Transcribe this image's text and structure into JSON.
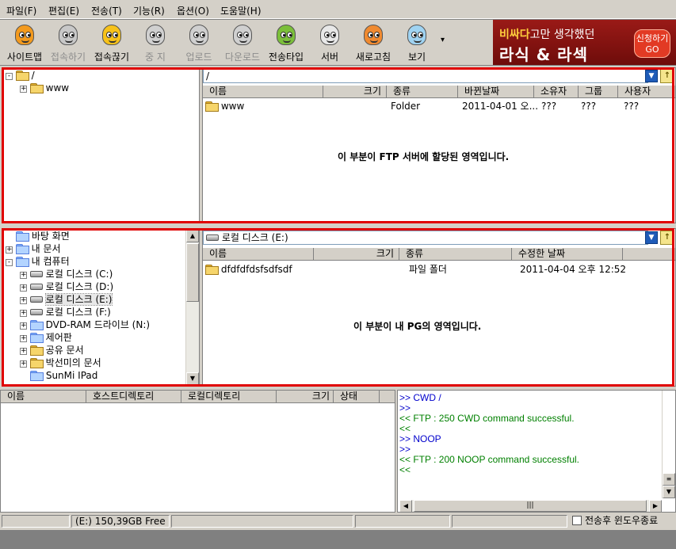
{
  "menu": [
    "파일(F)",
    "편집(E)",
    "전송(T)",
    "기능(R)",
    "옵션(O)",
    "도움말(H)"
  ],
  "toolbar": [
    {
      "label": "사이트맵",
      "icon": "sitemap-icon",
      "enabled": true,
      "color": "#f39a1e"
    },
    {
      "label": "접속하기",
      "icon": "connect-icon",
      "enabled": false,
      "color": "#c8c8c8"
    },
    {
      "label": "접속끊기",
      "icon": "disconnect-icon",
      "enabled": true,
      "color": "#f7c21a"
    },
    {
      "label": "중 지",
      "icon": "stop-icon",
      "enabled": false,
      "color": "#d0d0d0"
    },
    {
      "label": "업로드",
      "icon": "upload-icon",
      "enabled": false,
      "color": "#d0d0d0"
    },
    {
      "label": "다운로드",
      "icon": "download-icon",
      "enabled": false,
      "color": "#d0d0d0"
    },
    {
      "label": "전송타입",
      "icon": "transfer-type-icon",
      "enabled": true,
      "color": "#7bbf3a"
    },
    {
      "label": "서버",
      "icon": "server-icon",
      "enabled": true,
      "color": "#e8e8e8"
    },
    {
      "label": "새로고침",
      "icon": "refresh-icon",
      "enabled": true,
      "color": "#f08a30"
    },
    {
      "label": "보기",
      "icon": "view-icon",
      "enabled": true,
      "color": "#9fd3f2"
    }
  ],
  "ad": {
    "line1_hl": "비싸다",
    "line1_rest": "고만 생각했던",
    "line2": "라식 & 라섹",
    "button": "신청하기 GO"
  },
  "server": {
    "tree_root": "/",
    "tree_child": "www",
    "path": "/",
    "columns": [
      "이름",
      "크기",
      "종류",
      "바뀐날짜",
      "소유자",
      "그룹",
      "사용자"
    ],
    "rows": [
      {
        "name": "www",
        "size": "",
        "type": "Folder",
        "date": "2011-04-01 오...",
        "owner": "???",
        "group": "???",
        "user": "???"
      }
    ],
    "note": "이 부분이 FTP 서버에 할당된 영역입니다."
  },
  "local": {
    "tree": [
      {
        "label": "바탕 화면",
        "icon": "desktop-icon",
        "indent": 0,
        "expander": ""
      },
      {
        "label": "내 문서",
        "icon": "my-documents-icon",
        "indent": 0,
        "expander": "+"
      },
      {
        "label": "내 컴퓨터",
        "icon": "my-computer-icon",
        "indent": 0,
        "expander": "-"
      },
      {
        "label": "로컬 디스크 (C:)",
        "icon": "disk-icon",
        "indent": 1,
        "expander": "+"
      },
      {
        "label": "로컬 디스크 (D:)",
        "icon": "disk-icon",
        "indent": 1,
        "expander": "+"
      },
      {
        "label": "로컬 디스크 (E:)",
        "icon": "disk-icon",
        "indent": 1,
        "expander": "+",
        "selected": true
      },
      {
        "label": "로컬 디스크 (F:)",
        "icon": "disk-icon",
        "indent": 1,
        "expander": "+"
      },
      {
        "label": "DVD-RAM 드라이브 (N:)",
        "icon": "dvd-icon",
        "indent": 1,
        "expander": "+"
      },
      {
        "label": "제어판",
        "icon": "control-panel-icon",
        "indent": 1,
        "expander": "+"
      },
      {
        "label": "공유 문서",
        "icon": "folder-icon",
        "indent": 1,
        "expander": "+"
      },
      {
        "label": "박선미의 문서",
        "icon": "folder-icon",
        "indent": 1,
        "expander": "+"
      },
      {
        "label": "SunMi IPad",
        "icon": "camera-icon",
        "indent": 1,
        "expander": ""
      }
    ],
    "path": "로컬 디스크 (E:)",
    "columns": [
      "이름",
      "크기",
      "종류",
      "수정한 날짜"
    ],
    "rows": [
      {
        "name": "dfdfdfdsfsdfsdf",
        "size": "",
        "type": "파일 폴더",
        "date": "2011-04-04 오후 12:52"
      }
    ],
    "note": "이 부분이 내 PG의 영역입니다."
  },
  "queue": {
    "columns": [
      "이름",
      "호스트디렉토리",
      "로컬디렉토리",
      "크기",
      "상태"
    ]
  },
  "log": [
    {
      "text": ">> CWD /",
      "kind": "cmd"
    },
    {
      "text": ">>",
      "kind": "cmd"
    },
    {
      "text": "<< FTP : 250 CWD command successful.",
      "kind": "resp"
    },
    {
      "text": "<<",
      "kind": "resp"
    },
    {
      "text": ">> NOOP",
      "kind": "cmd"
    },
    {
      "text": ">>",
      "kind": "cmd"
    },
    {
      "text": "<< FTP : 200 NOOP command successful.",
      "kind": "resp"
    },
    {
      "text": "<<",
      "kind": "resp"
    }
  ],
  "status": {
    "disk_free": "(E:)  150,39GB Free",
    "shutdown_label": "전송후 윈도우종료"
  }
}
